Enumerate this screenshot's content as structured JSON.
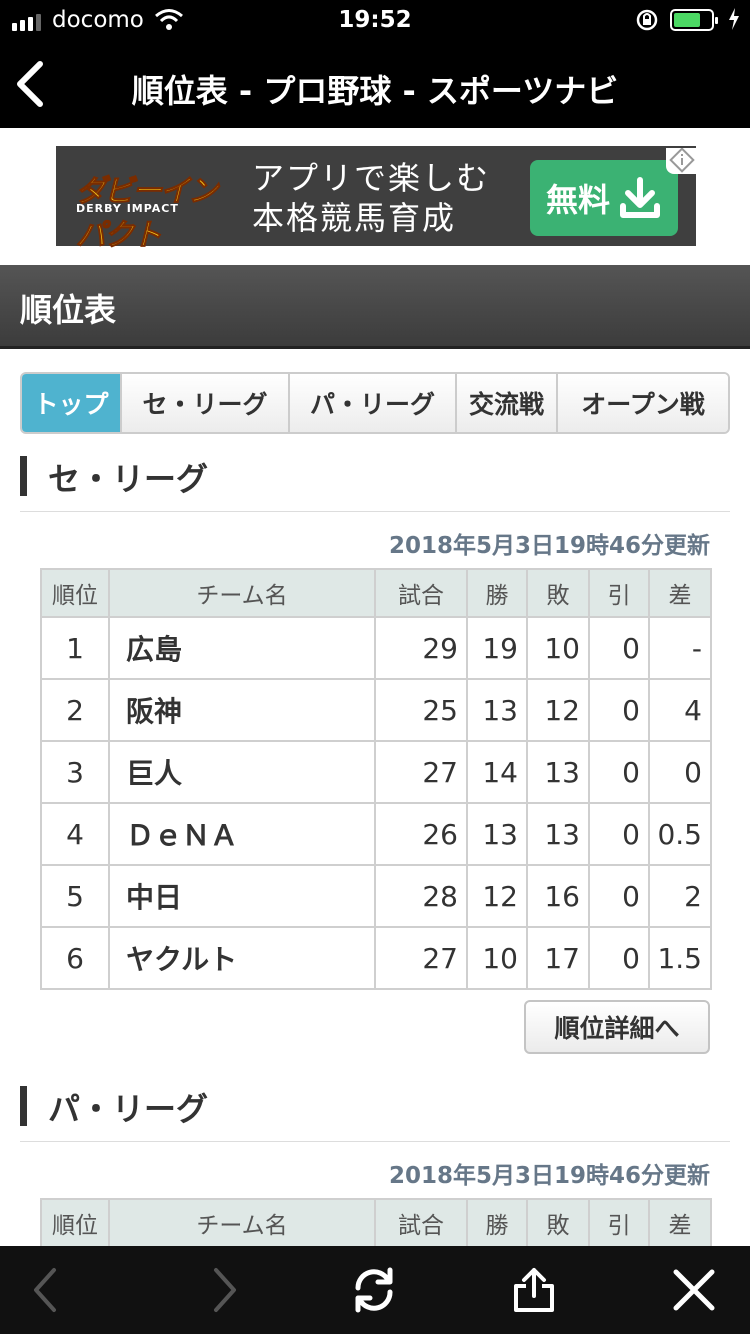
{
  "status_bar": {
    "carrier": "docomo",
    "time": "19:52"
  },
  "nav": {
    "title": "順位表 - プロ野球 - スポーツナビ"
  },
  "ad": {
    "logo_text": "ダビーインパクト",
    "logo_sub": "DERBY IMPACT",
    "copy_line1": "アプリで楽しむ",
    "copy_line2": "本格競馬育成",
    "button_label": "無料"
  },
  "page": {
    "heading": "順位表"
  },
  "tabs": [
    {
      "label": "トップ",
      "active": true
    },
    {
      "label": "セ・リーグ",
      "active": false
    },
    {
      "label": "パ・リーグ",
      "active": false
    },
    {
      "label": "交流戦",
      "active": false
    },
    {
      "label": "オープン戦",
      "active": false
    }
  ],
  "table_headers": [
    "順位",
    "チーム名",
    "試合",
    "勝",
    "敗",
    "引",
    "差"
  ],
  "central": {
    "title": "セ・リーグ",
    "updated": "2018年5月3日19時46分更新",
    "rows": [
      {
        "rank": "1",
        "team": "広島",
        "games": "29",
        "wins": "19",
        "losses": "10",
        "draws": "0",
        "gb": "-"
      },
      {
        "rank": "2",
        "team": "阪神",
        "games": "25",
        "wins": "13",
        "losses": "12",
        "draws": "0",
        "gb": "4"
      },
      {
        "rank": "3",
        "team": "巨人",
        "games": "27",
        "wins": "14",
        "losses": "13",
        "draws": "0",
        "gb": "0"
      },
      {
        "rank": "4",
        "team": "ＤｅＮＡ",
        "games": "26",
        "wins": "13",
        "losses": "13",
        "draws": "0",
        "gb": "0.5"
      },
      {
        "rank": "5",
        "team": "中日",
        "games": "28",
        "wins": "12",
        "losses": "16",
        "draws": "0",
        "gb": "2"
      },
      {
        "rank": "6",
        "team": "ヤクルト",
        "games": "27",
        "wins": "10",
        "losses": "17",
        "draws": "0",
        "gb": "1.5"
      }
    ],
    "detail_button": "順位詳細へ"
  },
  "pacific": {
    "title": "パ・リーグ",
    "updated": "2018年5月3日19時46分更新"
  },
  "colors": {
    "tab_active": "#4fb3cf",
    "team_link": "#1447c8",
    "ad_button": "#3bb273"
  }
}
